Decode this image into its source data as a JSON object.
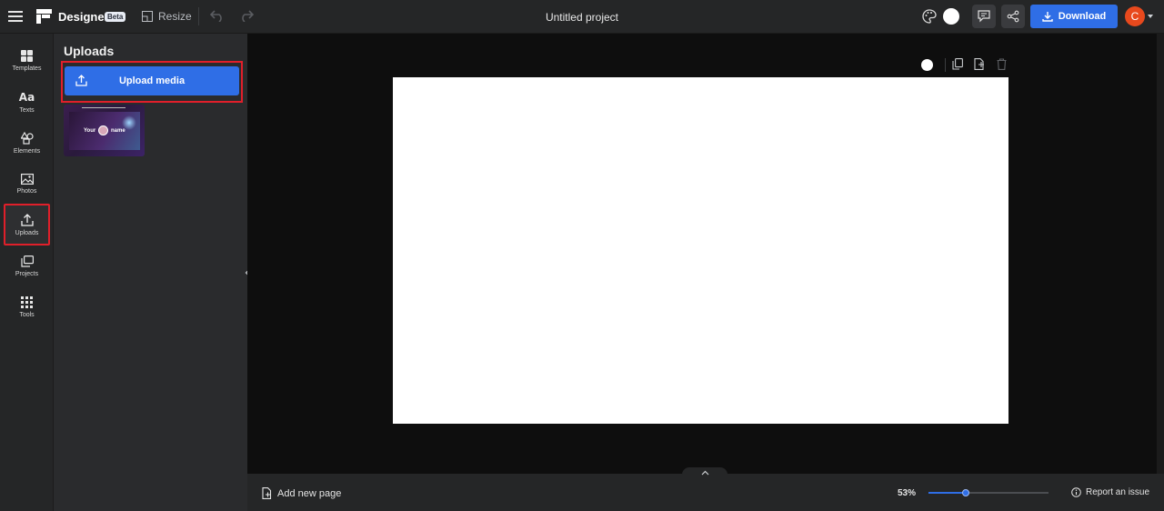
{
  "topbar": {
    "app_name": "Designer",
    "beta_badge": "Beta",
    "resize_label": "Resize",
    "project_title": "Untitled project",
    "download_label": "Download",
    "avatar_initial": "C"
  },
  "leftnav": {
    "items": [
      {
        "label": "Templates",
        "icon": "templates-icon"
      },
      {
        "label": "Texts",
        "icon": "texts-icon"
      },
      {
        "label": "Elements",
        "icon": "elements-icon"
      },
      {
        "label": "Photos",
        "icon": "photos-icon"
      },
      {
        "label": "Uploads",
        "icon": "uploads-icon",
        "active": true
      },
      {
        "label": "Projects",
        "icon": "projects-icon"
      },
      {
        "label": "Tools",
        "icon": "tools-icon"
      }
    ]
  },
  "panel": {
    "title": "Uploads",
    "upload_button": "Upload media",
    "thumbnail": {
      "text_left": "Your",
      "text_right": "name"
    }
  },
  "bottom": {
    "add_page": "Add new page",
    "zoom": "53%",
    "zoom_fraction": 0.31,
    "report_issue": "Report an issue"
  },
  "colors": {
    "accent": "#2f6ee6",
    "highlight": "#e01f2a",
    "avatar": "#e8491d"
  }
}
